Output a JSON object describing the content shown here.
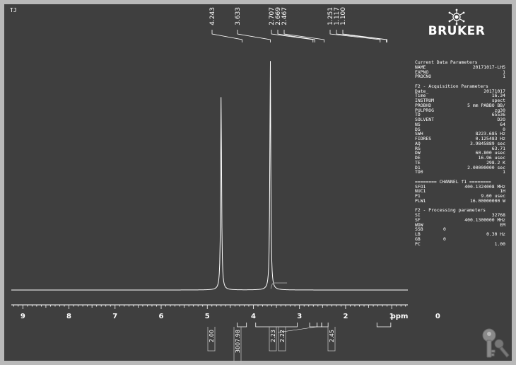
{
  "spectrum_label": "TJ",
  "brand": {
    "name": "BRUKER",
    "icon": "bruker-logo-icon"
  },
  "corner_icon": "key-icon",
  "params": {
    "sections": [
      {
        "rows": [
          {
            "k": "Current Data Parameters",
            "v": ""
          },
          {
            "k": "NAME",
            "v": "20171017-LHS"
          },
          {
            "k": "EXPNO",
            "v": "1"
          },
          {
            "k": "PROCNO",
            "v": "1"
          }
        ]
      },
      {
        "rows": [
          {
            "k": "F2 - Acquisition Parameters",
            "v": ""
          },
          {
            "k": "Date_",
            "v": "20171017"
          },
          {
            "k": "Time",
            "v": "16.34"
          },
          {
            "k": "INSTRUM",
            "v": "spect"
          },
          {
            "k": "PROBHD",
            "v": "5 mm PABBO BB/"
          },
          {
            "k": "PULPROG",
            "v": "zg30"
          },
          {
            "k": "TD",
            "v": "65536"
          },
          {
            "k": "SOLVENT",
            "v": "D2O"
          },
          {
            "k": "NS",
            "v": "64"
          },
          {
            "k": "DS",
            "v": "0"
          },
          {
            "k": "SWH",
            "v": "8223.685 Hz"
          },
          {
            "k": "FIDRES",
            "v": "0.125483 Hz"
          },
          {
            "k": "AQ",
            "v": "3.9845889 sec"
          },
          {
            "k": "RG",
            "v": "63.71"
          },
          {
            "k": "DW",
            "v": "60.800 usec"
          },
          {
            "k": "DE",
            "v": "16.96 usec"
          },
          {
            "k": "TE",
            "v": "298.2 K"
          },
          {
            "k": "D1",
            "v": "2.00000000 sec"
          },
          {
            "k": "TD0",
            "v": "1"
          }
        ]
      },
      {
        "rows": [
          {
            "k": "======== CHANNEL f1 ========",
            "v": ""
          },
          {
            "k": "SFO1",
            "v": "400.1324008 MHz"
          },
          {
            "k": "NUC1",
            "v": "1H"
          },
          {
            "k": "P1",
            "v": "9.60 usec"
          },
          {
            "k": "PLW1",
            "v": "16.00000000 W"
          }
        ]
      },
      {
        "rows": [
          {
            "k": "F2 - Processing parameters",
            "v": ""
          },
          {
            "k": "SI",
            "v": "32768"
          },
          {
            "k": "SF",
            "v": "400.1300000 MHz"
          },
          {
            "k": "WDW",
            "v": "EM"
          },
          {
            "k": "SSB",
            "v": "0",
            "short": true
          },
          {
            "k": "LB",
            "v": "0.30 Hz"
          },
          {
            "k": "GB",
            "v": "0",
            "short": true
          },
          {
            "k": "PC",
            "v": "1.00"
          }
        ]
      }
    ]
  },
  "chart_data": {
    "type": "line",
    "xlabel": "ppm",
    "xlim": [
      9.25,
      0.65
    ],
    "reversed_x_axis": true,
    "x_ticks": [
      9,
      8,
      7,
      6,
      5,
      4,
      3,
      2,
      1,
      0
    ],
    "peaks": [
      {
        "ppm": 4.7,
        "relative_height": 0.84
      },
      {
        "ppm": 3.633,
        "relative_height": 1.0
      }
    ],
    "peak_labels": [
      "4.243",
      "3.633",
      "2.707",
      "2.669",
      "2.467",
      "1.251",
      "1.117",
      "1.100"
    ],
    "peak_label_ppm": [
      4.243,
      3.633,
      2.707,
      2.669,
      2.467,
      1.251,
      1.117,
      1.1
    ],
    "integrals": [
      {
        "value": "2.00",
        "from": 4.35,
        "to": 4.15
      },
      {
        "value": "3007.98",
        "from": 3.95,
        "to": 3.05
      },
      {
        "value": "2.23",
        "from": 2.78,
        "to": 2.62
      },
      {
        "value": "2.23",
        "from": 2.62,
        "to": 2.52
      },
      {
        "value": "2.22",
        "from": 2.52,
        "to": 2.38
      },
      {
        "value": "2.45",
        "from": 1.32,
        "to": 1.02
      }
    ]
  }
}
